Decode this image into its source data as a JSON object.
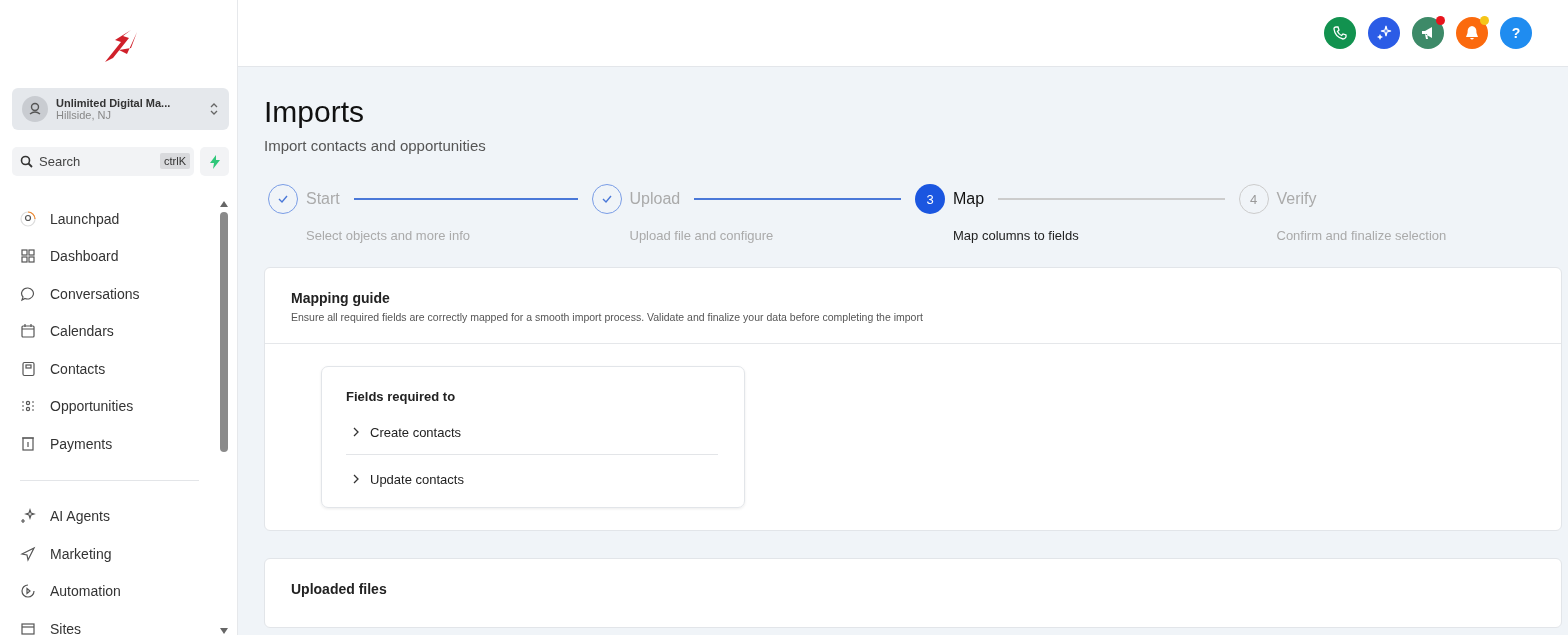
{
  "account": {
    "name": "Unlimited Digital Ma...",
    "location": "Hillside, NJ"
  },
  "search": {
    "placeholder": "Search",
    "shortcut": "ctrlK"
  },
  "sidebar": {
    "groups": [
      {
        "items": [
          {
            "label": "Launchpad"
          },
          {
            "label": "Dashboard"
          },
          {
            "label": "Conversations"
          },
          {
            "label": "Calendars"
          },
          {
            "label": "Contacts"
          },
          {
            "label": "Opportunities"
          },
          {
            "label": "Payments"
          }
        ]
      },
      {
        "items": [
          {
            "label": "AI Agents"
          },
          {
            "label": "Marketing"
          },
          {
            "label": "Automation"
          },
          {
            "label": "Sites"
          }
        ]
      }
    ]
  },
  "header_buttons": [
    {
      "kind": "phone",
      "color": "#12924f",
      "badge": false
    },
    {
      "kind": "sparkle",
      "color": "#2b5ce6",
      "badge": false
    },
    {
      "kind": "megaphone",
      "color": "#3d8a68",
      "badge": true
    },
    {
      "kind": "bell",
      "color": "#fb6a0e",
      "badge": true
    },
    {
      "kind": "help",
      "color": "#1f8cf0",
      "badge": false,
      "text": "?"
    }
  ],
  "page": {
    "title": "Imports",
    "subtitle": "Import contacts and opportunities"
  },
  "steps": [
    {
      "kind": "done",
      "title": "Start",
      "description": "Select objects and more info"
    },
    {
      "kind": "done",
      "title": "Upload",
      "description": "Upload file and configure"
    },
    {
      "kind": "current",
      "number": "3",
      "title": "Map",
      "description": "Map columns to fields"
    },
    {
      "kind": "todo",
      "number": "4",
      "title": "Verify",
      "description": "Confirm and finalize selection"
    }
  ],
  "mapping_guide": {
    "title": "Mapping guide",
    "description": "Ensure all required fields are correctly mapped for a smooth import process. Validate and finalize your data before completing the import",
    "fields_card": {
      "title": "Fields required to",
      "items": [
        {
          "label": "Create contacts",
          "expanded": false
        },
        {
          "label": "Update contacts",
          "expanded": false
        }
      ]
    }
  },
  "uploaded_files": {
    "title": "Uploaded files"
  }
}
